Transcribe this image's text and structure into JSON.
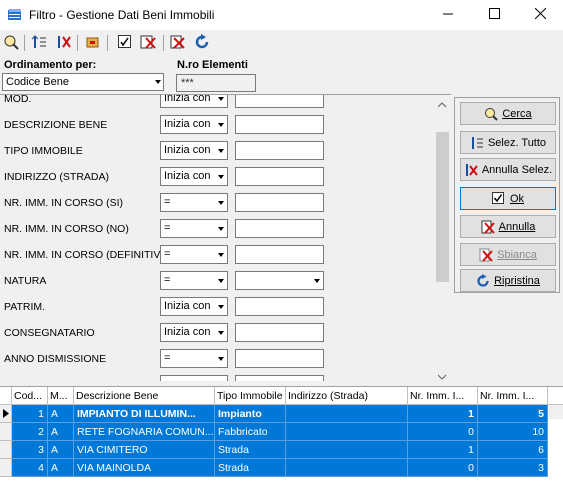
{
  "window": {
    "title": "Filtro - Gestione Dati Beni Immobili",
    "app_icon": "book-stack-icon"
  },
  "toolbar": {
    "icons": [
      "search-filter-icon",
      "sort-asc-icon",
      "sort-clear-icon",
      "export-icon",
      "check-icon",
      "uncheck-icon",
      "clear-icon",
      "refresh-icon"
    ]
  },
  "ordering": {
    "label": "Ordinamento per:",
    "value": "Codice Bene"
  },
  "count": {
    "label": "N.ro Elementi",
    "value": "***"
  },
  "filters": [
    {
      "label": "MOD.",
      "op": "Inizia con",
      "value": ""
    },
    {
      "label": "DESCRIZIONE BENE",
      "op": "Inizia con",
      "value": ""
    },
    {
      "label": "TIPO IMMOBILE",
      "op": "Inizia con",
      "value": ""
    },
    {
      "label": "INDIRIZZO (STRADA)",
      "op": "Inizia con",
      "value": ""
    },
    {
      "label": "NR. IMM. IN CORSO (SI)",
      "op": "=",
      "value": ""
    },
    {
      "label": "NR. IMM. IN CORSO (NO)",
      "op": "=",
      "value": ""
    },
    {
      "label": "NR. IMM. IN CORSO (DEFINITIVI)",
      "op": "=",
      "value": ""
    },
    {
      "label": "NATURA",
      "op": "=",
      "value": ""
    },
    {
      "label": "PATRIM.",
      "op": "Inizia con",
      "value": ""
    },
    {
      "label": "CONSEGNATARIO",
      "op": "Inizia con",
      "value": ""
    },
    {
      "label": "ANNO DISMISSIONE",
      "op": "=",
      "value": ""
    }
  ],
  "actions": {
    "cerca": "Cerca",
    "selez_tutto": "Selez. Tutto",
    "annulla_selez": "Annulla Selez.",
    "ok": "Ok",
    "annulla": "Annulla",
    "sbianca": "Sbianca",
    "ripristina": "Ripristina"
  },
  "grid": {
    "columns": [
      "Cod...",
      "M...",
      "Descrizione Bene",
      "Tipo Immobile",
      "Indirizzo (Strada)",
      "Nr. Imm. I...",
      "Nr. Imm. I..."
    ],
    "rows": [
      {
        "cod": "1",
        "m": "A",
        "desc": "IMPIANTO DI ILLUMIN...",
        "tipo": "Impianto",
        "indirizzo": "",
        "n1": "1",
        "n2": "5"
      },
      {
        "cod": "2",
        "m": "A",
        "desc": "RETE FOGNARIA COMUN...",
        "tipo": "Fabbricato",
        "indirizzo": "",
        "n1": "0",
        "n2": "10"
      },
      {
        "cod": "3",
        "m": "A",
        "desc": "VIA CIMITERO",
        "tipo": "Strada",
        "indirizzo": "",
        "n1": "1",
        "n2": "6"
      },
      {
        "cod": "4",
        "m": "A",
        "desc": "VIA MAINOLDA",
        "tipo": "Strada",
        "indirizzo": "",
        "n1": "0",
        "n2": "3"
      }
    ]
  },
  "colors": {
    "selection": "#0078d7",
    "window_bg": "#f0f0f0"
  }
}
